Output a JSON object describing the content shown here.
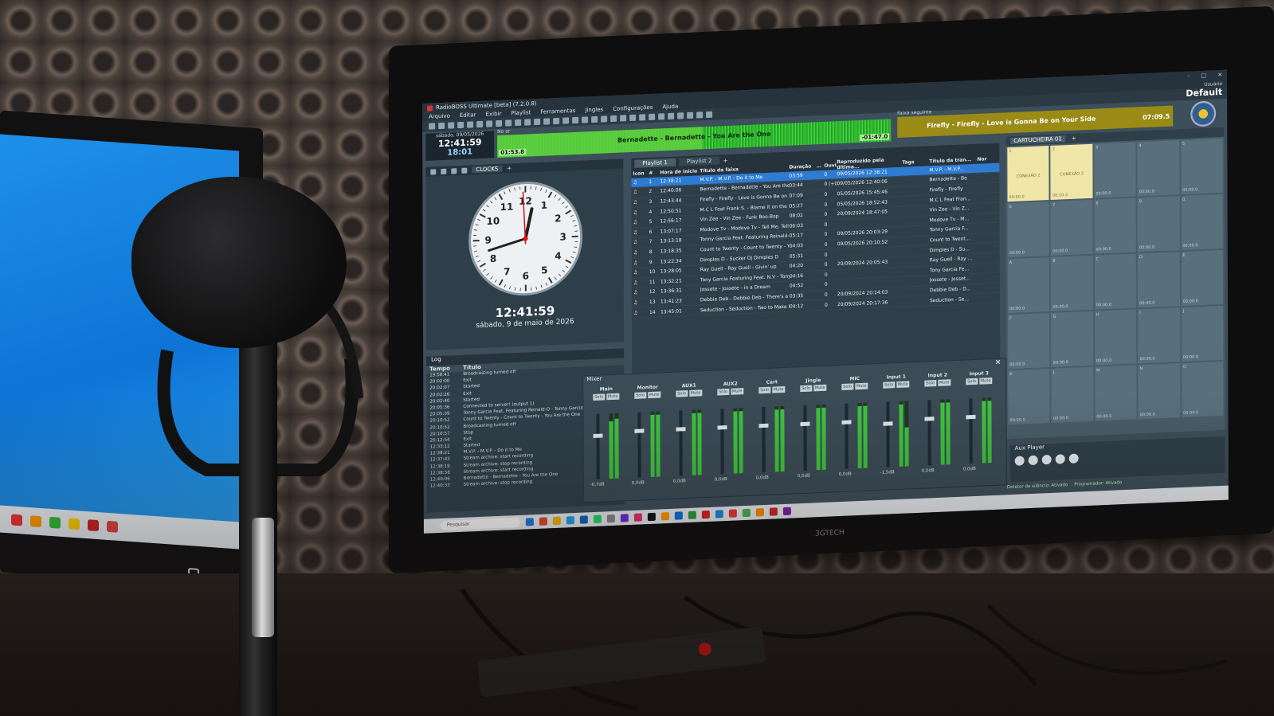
{
  "window": {
    "title": "RadioBOSS Ultimate [beta] (7.2.0.8)",
    "menu": [
      "Arquivo",
      "Editar",
      "Exibir",
      "Playlist",
      "Ferramentas",
      "Jingles",
      "Configurações",
      "Ajuda"
    ],
    "user_label": "Usuário",
    "profile": "Default"
  },
  "onair": {
    "date": "sábado, 09/05/2026",
    "time": "12:41:59",
    "countdown": "18:01",
    "label": "No ar",
    "title": "Bernadette - Bernadette - You Are the One",
    "elapsed": "01:53.8",
    "remaining": "-01:47.0",
    "progress": 0.52
  },
  "next": {
    "label": "Faixa seguinte",
    "title": "Firefly - Firefly - Love is Gonna Be on Your Side",
    "duration": "07:09.5"
  },
  "clock": {
    "tab": "CLOCKS",
    "time": "12:41:59",
    "date": "sábado, 9 de maio de 2026",
    "numbers": [
      "12",
      "1",
      "2",
      "3",
      "4",
      "5",
      "6",
      "7",
      "8",
      "9",
      "10",
      "11"
    ]
  },
  "playlist": {
    "tabs": [
      "Playlist 1",
      "Playlist 2"
    ],
    "columns": [
      "Icon",
      "#",
      "Hora de início",
      "Título da faixa",
      "Duração",
      "...",
      "Ouvi...",
      "Reproduzido pela última...",
      "Tags",
      "Título da tran...",
      "Nor"
    ],
    "rows": [
      {
        "n": "1",
        "start": "12:38:21",
        "title": "M.V.P. - M.V.P. - Do it to Me",
        "dur": "03:59",
        "o": "0",
        "last": "09/05/2026 12:38:21",
        "short": "M.V.P. - M.V.P..."
      },
      {
        "n": "2",
        "start": "12:40:06",
        "title": "Bernadette - Bernadette - You Are the",
        "dur": "03:44",
        "o": "0 (+0)",
        "last": "09/05/2026 12:40:06",
        "short": "Bernadette - Be"
      },
      {
        "n": "3",
        "start": "12:43:44",
        "title": "Firefly - Firefly - Love is Gonna Be on Y",
        "dur": "07:09",
        "o": "0",
        "last": "05/05/2026 15:45:46",
        "short": "Firefly - Firefly"
      },
      {
        "n": "4",
        "start": "12:50:51",
        "title": "M.C L Feat Frank S. - Blame it on the So",
        "dur": "05:27",
        "o": "0",
        "last": "05/05/2026 18:52:43",
        "short": "M.C L Feat Fran..."
      },
      {
        "n": "5",
        "start": "12:56:17",
        "title": "Vin Zee - Vin Zee - Funk Boo-Bop",
        "dur": "08:02",
        "o": "0",
        "last": "20/09/2024 18:47:05",
        "short": "Vin Zee - Vin Z..."
      },
      {
        "n": "6",
        "start": "13:07:17",
        "title": "Modove Tv - Modove Tv - Tell Me, Tell Me",
        "dur": "06:03",
        "o": "0",
        "last": "",
        "short": "Modove Tv - M..."
      },
      {
        "n": "7",
        "start": "13:13:18",
        "title": "Tonny Garcia Feat. Featuring Reinald-O",
        "dur": "05:17",
        "o": "0",
        "last": "09/05/2026 20:03:29",
        "short": "Tonny Garcia F..."
      },
      {
        "n": "8",
        "start": "13:18:35",
        "title": "Count to Twenty - Count to Twenty - Y...",
        "dur": "04:03",
        "o": "0",
        "last": "09/05/2026 20:10:52",
        "short": "Count to Twent..."
      },
      {
        "n": "9",
        "start": "13:22:34",
        "title": "Dimples D - Sucker Dj Dimples D",
        "dur": "05:31",
        "o": "0",
        "last": "",
        "short": "Dimples D - Su..."
      },
      {
        "n": "10",
        "start": "13:28:05",
        "title": "Ray Guell - Ray Guell - Givin' up",
        "dur": "04:20",
        "o": "0",
        "last": "20/09/2024 20:05:43",
        "short": "Ray Guell - Ray ..."
      },
      {
        "n": "11",
        "start": "13:32:21",
        "title": "Tony Garcia Featuring Feat. N.V - Tony ...",
        "dur": "04:16",
        "o": "0",
        "last": "",
        "short": "Tony Garcia Fe..."
      },
      {
        "n": "12",
        "start": "13:36:31",
        "title": "Jossete - Jossete - in a Dream",
        "dur": "04:52",
        "o": "0",
        "last": "",
        "short": "Jossete - Josset..."
      },
      {
        "n": "13",
        "start": "13:41:23",
        "title": "Debbie Deb - Debbie Deb - There's a Pa",
        "dur": "03:35",
        "o": "0",
        "last": "20/09/2024 20:14:03",
        "short": "Debbie Deb - D..."
      },
      {
        "n": "14",
        "start": "13:45:01",
        "title": "Seduction - Seduction - Two to Make It...",
        "dur": "04:12",
        "o": "0",
        "last": "20/09/2024 20:17:36",
        "short": "Seduction - Se..."
      }
    ]
  },
  "cart": {
    "tab": "CARTUCHEIRA 01",
    "cells": [
      {
        "k": "1",
        "label": "CONEXÃO 2",
        "time": "00:00.0",
        "filled": true
      },
      {
        "k": "2",
        "label": "CONEXÃO 2",
        "time": "00:10.3",
        "filled": true
      },
      {
        "k": "3",
        "label": "",
        "time": "00:00.0",
        "filled": false
      },
      {
        "k": "4",
        "label": "",
        "time": "00:00.0",
        "filled": false
      },
      {
        "k": "5",
        "label": "",
        "time": "00:00.0",
        "filled": false
      },
      {
        "k": "6",
        "label": "",
        "time": "00:00.0",
        "filled": false
      },
      {
        "k": "7",
        "label": "",
        "time": "00:00.0",
        "filled": false
      },
      {
        "k": "8",
        "label": "",
        "time": "00:00.0",
        "filled": false
      },
      {
        "k": "9",
        "label": "",
        "time": "00:00.0",
        "filled": false
      },
      {
        "k": "0",
        "label": "",
        "time": "00:00.0",
        "filled": false
      },
      {
        "k": "A",
        "label": "",
        "time": "00:00.0",
        "filled": false
      },
      {
        "k": "B",
        "label": "",
        "time": "00:00.0",
        "filled": false
      },
      {
        "k": "C",
        "label": "",
        "time": "00:00.0",
        "filled": false
      },
      {
        "k": "D",
        "label": "",
        "time": "00:00.0",
        "filled": false
      },
      {
        "k": "E",
        "label": "",
        "time": "00:00.0",
        "filled": false
      },
      {
        "k": "F",
        "label": "",
        "time": "00:00.0",
        "filled": false
      },
      {
        "k": "G",
        "label": "",
        "time": "00:00.0",
        "filled": false
      },
      {
        "k": "H",
        "label": "",
        "time": "00:00.0",
        "filled": false
      },
      {
        "k": "I",
        "label": "",
        "time": "00:00.0",
        "filled": false
      },
      {
        "k": "J",
        "label": "",
        "time": "00:00.0",
        "filled": false
      },
      {
        "k": "K",
        "label": "",
        "time": "00:00.0",
        "filled": false
      },
      {
        "k": "L",
        "label": "",
        "time": "00:00.0",
        "filled": false
      },
      {
        "k": "M",
        "label": "",
        "time": "00:00.0",
        "filled": false
      },
      {
        "k": "N",
        "label": "",
        "time": "00:00.0",
        "filled": false
      },
      {
        "k": "O",
        "label": "",
        "time": "00:00.0",
        "filled": false
      }
    ]
  },
  "log": {
    "tab": "Log",
    "columns": [
      "Tempo",
      "Título"
    ],
    "rows": [
      {
        "t": "19:58:41",
        "m": "Broadcasting turned off"
      },
      {
        "t": "20:02:00",
        "m": "Exit"
      },
      {
        "t": "20:02:07",
        "m": "Started"
      },
      {
        "t": "20:02:26",
        "m": "Exit"
      },
      {
        "t": "20:02:40",
        "m": "Started"
      },
      {
        "t": "20:05:36",
        "m": "Connected to server! (output 1)"
      },
      {
        "t": "20:05:39",
        "m": "Tonny Garcia Feat. Featuring Reinald-O - Tonny Garcia Fe"
      },
      {
        "t": "20:10:52",
        "m": "Count to Twenty - Count to Twenty - You Are the One"
      },
      {
        "t": "20:10:52",
        "m": "Broadcasting turned off"
      },
      {
        "t": "20:10:57",
        "m": "Stop"
      },
      {
        "t": "20:12:54",
        "m": "Exit"
      },
      {
        "t": "12:33:12",
        "m": "Started"
      },
      {
        "t": "12:38:21",
        "m": "M.V.P. - M.V.P. - Do it to Me"
      },
      {
        "t": "12:37:43",
        "m": "Stream archive: start recording"
      },
      {
        "t": "12:38:19",
        "m": "Stream archive: stop recording"
      },
      {
        "t": "12:38:58",
        "m": "Stream archive: start recording"
      },
      {
        "t": "12:40:06",
        "m": "Bernadette - Bernadette - You Are the One"
      },
      {
        "t": "12:40:33",
        "m": "Stream archive: stop recording"
      }
    ]
  },
  "mixer": {
    "title": "Mixer",
    "solo_label": "Solo",
    "mute_label": "Mute",
    "channels": [
      {
        "name": "Main",
        "db": "-0,7dB",
        "level": 0.7,
        "meter_l": 0.88,
        "meter_r": 0.92
      },
      {
        "name": "Monitor",
        "db": "0,0dB",
        "level": 0.75,
        "meter_l": 0.95,
        "meter_r": 0.95
      },
      {
        "name": "AUX1",
        "db": "0,0dB",
        "level": 0.75,
        "meter_l": 0.95,
        "meter_r": 0.95
      },
      {
        "name": "AUX2",
        "db": "0,0dB",
        "level": 0.75,
        "meter_l": 0.95,
        "meter_r": 0.95
      },
      {
        "name": "Cart",
        "db": "0,0dB",
        "level": 0.75,
        "meter_l": 0.95,
        "meter_r": 0.95
      },
      {
        "name": "Jingle",
        "db": "0,0dB",
        "level": 0.75,
        "meter_l": 0.95,
        "meter_r": 0.95
      },
      {
        "name": "MIC",
        "db": "0,0dB",
        "level": 0.75,
        "meter_l": 0.95,
        "meter_r": 0.95
      },
      {
        "name": "Input 1",
        "db": "-1,5dB",
        "level": 0.7,
        "meter_l": 0.95,
        "meter_r": 0.6
      },
      {
        "name": "Input 2",
        "db": "0,0dB",
        "level": 0.75,
        "meter_l": 0.95,
        "meter_r": 0.95
      },
      {
        "name": "Input 3",
        "db": "0,0dB",
        "level": 0.75,
        "meter_l": 0.95,
        "meter_r": 0.95
      }
    ]
  },
  "aux": {
    "tab": "Aux Player"
  },
  "status": {
    "silence": "Detetor de silêncio: Ativado",
    "scheduler": "Programador: Ativado"
  },
  "taskbar": {
    "search_placeholder": "Pesquisar"
  },
  "monitor_brand": "3GTECH",
  "colors": {
    "accent": "#2e7bd2",
    "onair": "#2db52d",
    "next": "#9a8a16",
    "panel": "#2f3f4a"
  }
}
